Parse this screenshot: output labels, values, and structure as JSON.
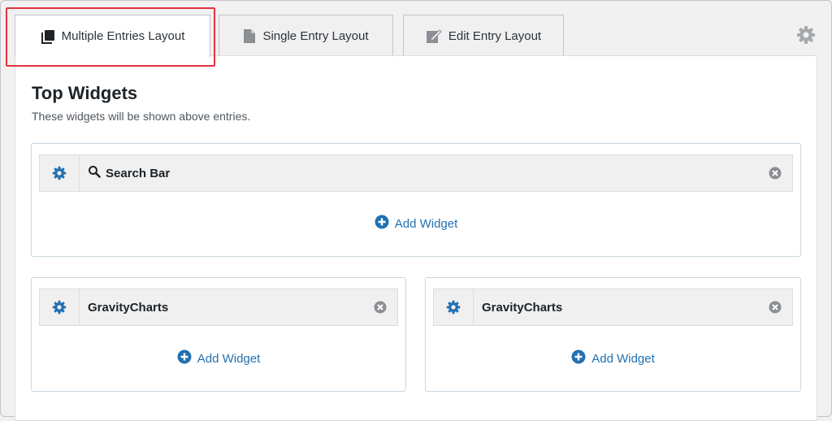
{
  "tabs": [
    {
      "label": "Multiple Entries Layout",
      "icon": "copy-icon",
      "active": true
    },
    {
      "label": "Single Entry Layout",
      "icon": "document-icon",
      "active": false
    },
    {
      "label": "Edit Entry Layout",
      "icon": "edit-icon",
      "active": false
    }
  ],
  "settings_icon": "gear-icon",
  "section": {
    "title": "Top Widgets",
    "description": "These widgets will be shown above entries."
  },
  "widget_areas": [
    {
      "widget": {
        "label": "Search Bar",
        "icon": "search-icon"
      },
      "add_label": "Add Widget"
    },
    {
      "widget": {
        "label": "GravityCharts"
      },
      "add_label": "Add Widget"
    },
    {
      "widget": {
        "label": "GravityCharts"
      },
      "add_label": "Add Widget"
    }
  ],
  "colors": {
    "accent": "#2271b1",
    "highlight": "#e3343f",
    "icon_gray": "#8c8f94"
  }
}
